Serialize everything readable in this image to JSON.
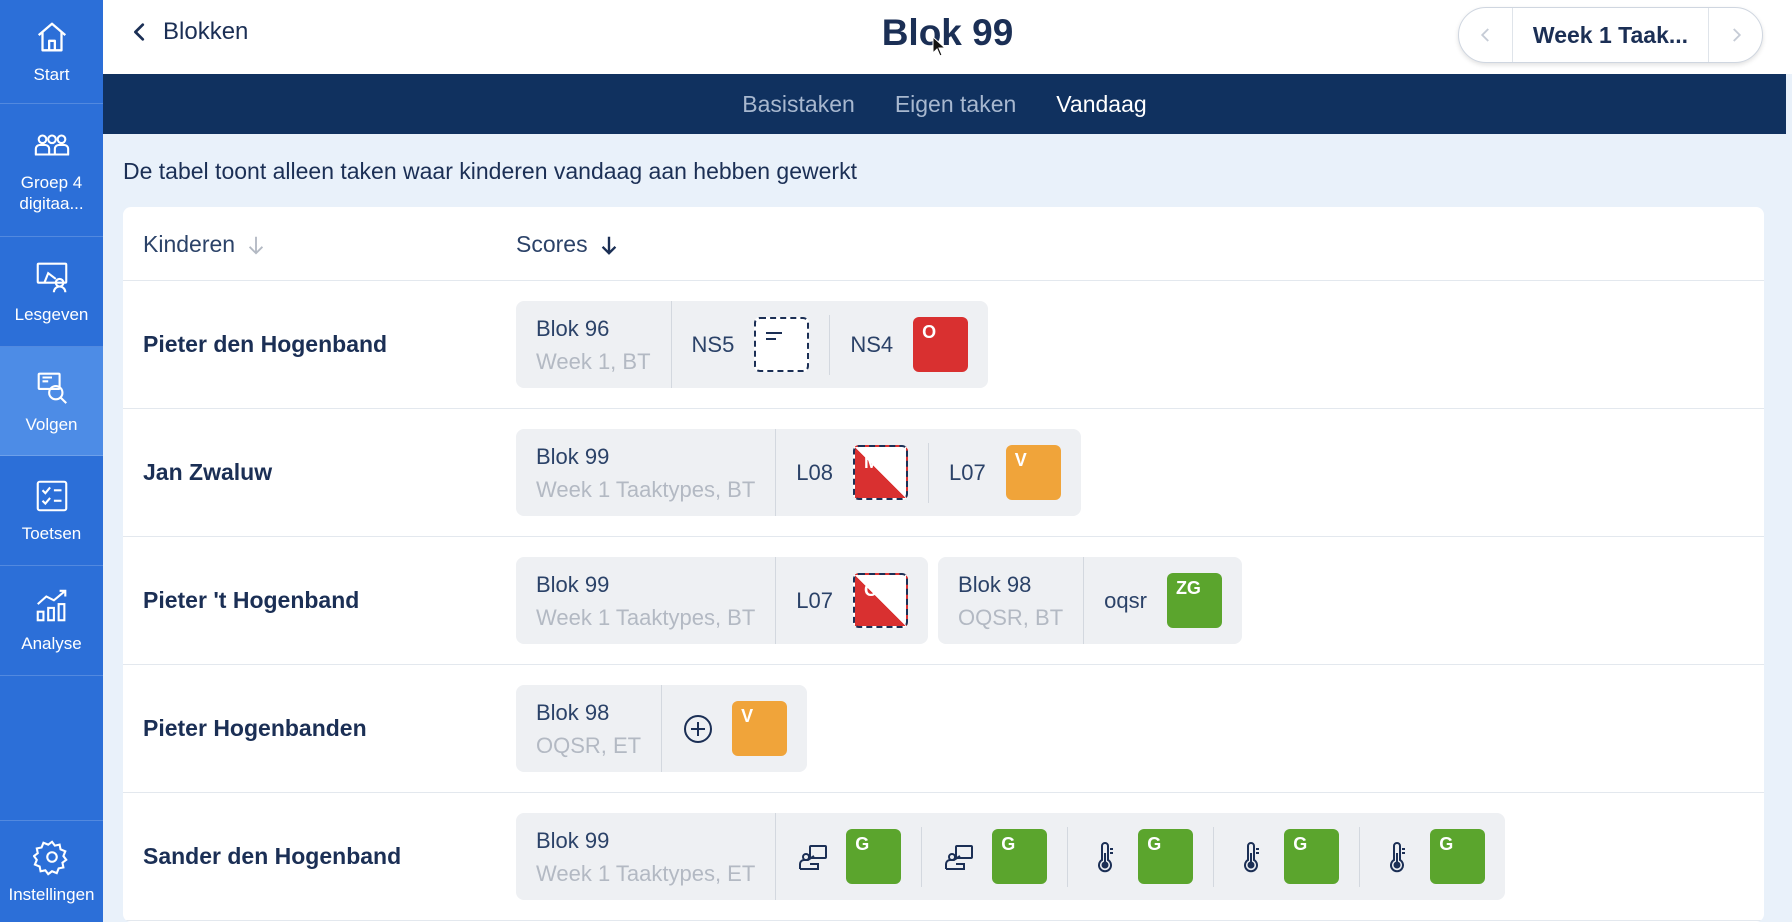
{
  "sidebar": {
    "items": [
      {
        "label": "Start",
        "icon": "home-icon"
      },
      {
        "label": "Groep 4 digitaa...",
        "icon": "group-icon"
      },
      {
        "label": "Lesgeven",
        "icon": "presentation-icon"
      },
      {
        "label": "Volgen",
        "icon": "monitor-search-icon",
        "active": true
      },
      {
        "label": "Toetsen",
        "icon": "checklist-icon"
      },
      {
        "label": "Analyse",
        "icon": "chart-icon"
      }
    ],
    "settings_label": "Instellingen"
  },
  "header": {
    "back_label": "Blokken",
    "title": "Blok 99",
    "week_label": "Week 1 Taak..."
  },
  "tabs": [
    "Basistaken",
    "Eigen taken",
    "Vandaag"
  ],
  "active_tab": "Vandaag",
  "info_text": "De tabel toont alleen taken waar kinderen vandaag aan hebben gewerkt",
  "table": {
    "col_kinderen": "Kinderen",
    "col_scores": "Scores",
    "rows": [
      {
        "name": "Pieter den Hogenband",
        "groups": [
          {
            "block": "Blok 96",
            "sub": "Week 1, BT",
            "items": [
              {
                "code": "NS5",
                "badge": "",
                "style": "empty"
              },
              {
                "code": "NS4",
                "badge": "O",
                "style": "red"
              }
            ]
          }
        ]
      },
      {
        "name": "Jan Zwaluw",
        "groups": [
          {
            "block": "Blok 99",
            "sub": "Week 1 Taaktypes, BT",
            "items": [
              {
                "code": "L08",
                "badge": "M",
                "style": "split"
              },
              {
                "code": "L07",
                "badge": "V",
                "style": "orange"
              }
            ]
          }
        ]
      },
      {
        "name": "Pieter 't Hogenband",
        "groups": [
          {
            "block": "Blok 99",
            "sub": "Week 1 Taaktypes, BT",
            "items": [
              {
                "code": "L07",
                "badge": "O",
                "style": "split"
              }
            ]
          },
          {
            "block": "Blok 98",
            "sub": "OQSR, BT",
            "items": [
              {
                "code": "oqsr",
                "badge": "ZG",
                "style": "green"
              }
            ]
          }
        ]
      },
      {
        "name": "Pieter Hogenbanden",
        "groups": [
          {
            "block": "Blok 98",
            "sub": "OQSR, ET",
            "items": [
              {
                "icon": "plus-circle-icon",
                "badge": "V",
                "style": "orange"
              }
            ]
          }
        ]
      },
      {
        "name": "Sander den Hogenband",
        "groups": [
          {
            "block": "Blok 99",
            "sub": "Week 1 Taaktypes, ET",
            "items": [
              {
                "icon": "teacher-icon",
                "badge": "G",
                "style": "green"
              },
              {
                "icon": "teacher-icon",
                "badge": "G",
                "style": "green"
              },
              {
                "icon": "thermometer-icon",
                "badge": "G",
                "style": "green"
              },
              {
                "icon": "thermometer-icon",
                "badge": "G",
                "style": "green"
              },
              {
                "icon": "thermometer-icon",
                "badge": "G",
                "style": "green"
              }
            ]
          }
        ]
      }
    ]
  },
  "colors": {
    "sidebar": "#2c6fd8",
    "sidebar_active": "#4d8ce6",
    "tabbar": "#10315f",
    "red": "#d93030",
    "orange": "#f0a43a",
    "green": "#5ba52d"
  }
}
